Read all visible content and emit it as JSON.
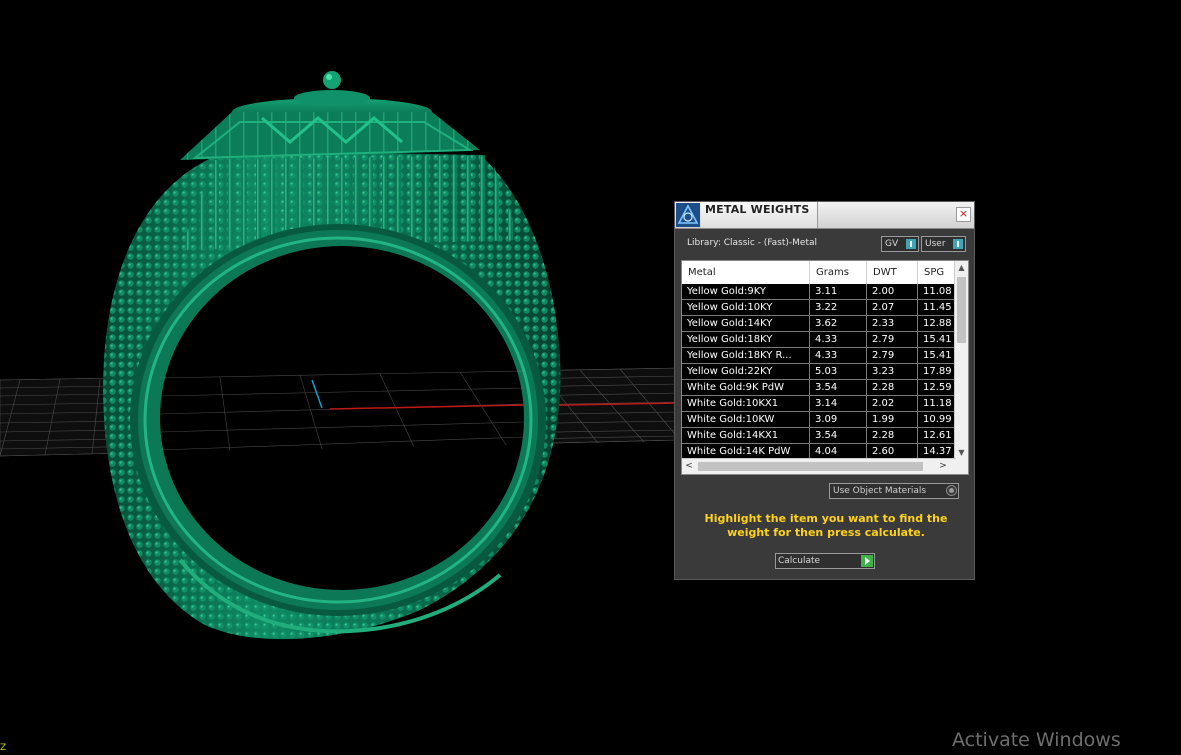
{
  "panel": {
    "title": "METAL WEIGHTS",
    "close": "×",
    "library": "Library: Classic - (Fast)-Metal",
    "toggle_gv": "GV",
    "toggle_user": "User",
    "columns": [
      "Metal",
      "Grams",
      "DWT",
      "SPG"
    ],
    "rows": [
      [
        "Yellow Gold:9KY",
        "3.11",
        "2.00",
        "11.08"
      ],
      [
        "Yellow Gold:10KY",
        "3.22",
        "2.07",
        "11.45"
      ],
      [
        "Yellow Gold:14KY",
        "3.62",
        "2.33",
        "12.88"
      ],
      [
        "Yellow Gold:18KY",
        "4.33",
        "2.79",
        "15.41"
      ],
      [
        "Yellow Gold:18KY R...",
        "4.33",
        "2.79",
        "15.41"
      ],
      [
        "Yellow Gold:22KY",
        "5.03",
        "3.23",
        "17.89"
      ],
      [
        "White Gold:9K PdW",
        "3.54",
        "2.28",
        "12.59"
      ],
      [
        "White Gold:10KX1",
        "3.14",
        "2.02",
        "11.18"
      ],
      [
        "White Gold:10KW",
        "3.09",
        "1.99",
        "10.99"
      ],
      [
        "White Gold:14KX1",
        "3.54",
        "2.28",
        "12.61"
      ],
      [
        "White Gold:14K PdW",
        "4.04",
        "2.60",
        "14.37"
      ]
    ],
    "scroll_up": "▲",
    "scroll_down": "▼",
    "scroll_left": "<",
    "scroll_right": ">",
    "dropdown_value": "Use Object Materials",
    "hint": "Highlight the item you want to find the weight for then press calculate.",
    "calculate_label": "Calculate"
  },
  "viewport": {
    "axis_label": "Z",
    "ring_color": "#0e7a5a",
    "grid_color": "#8a8a8a",
    "x_axis_color": "#c01818",
    "y_axis_color": "#18a0c8"
  },
  "watermark": "Activate Windows"
}
